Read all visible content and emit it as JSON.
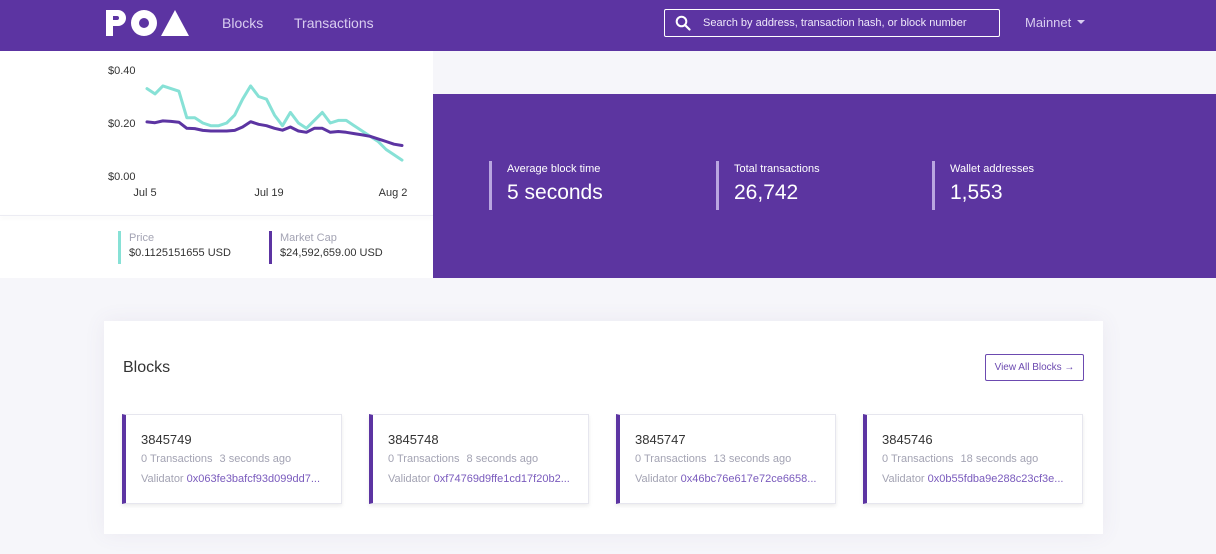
{
  "navbar": {
    "brand": "POA",
    "links": [
      {
        "label": "Blocks"
      },
      {
        "label": "Transactions"
      }
    ],
    "search_placeholder": "Search by address, transaction hash, or block number",
    "network": "Mainnet"
  },
  "chart_data": {
    "type": "line",
    "x_tick_labels": [
      "Jul 5",
      "Jul 19",
      "Aug 2"
    ],
    "y_tick_labels": [
      "$0.40",
      "$0.20",
      "$0.00"
    ],
    "ylim": [
      0,
      0.4
    ],
    "series": [
      {
        "name": "Price",
        "color": "#87e1d6",
        "values": [
          0.33,
          0.31,
          0.34,
          0.33,
          0.32,
          0.22,
          0.22,
          0.2,
          0.19,
          0.19,
          0.2,
          0.23,
          0.29,
          0.34,
          0.3,
          0.29,
          0.23,
          0.19,
          0.24,
          0.2,
          0.18,
          0.21,
          0.24,
          0.2,
          0.21,
          0.21,
          0.19,
          0.17,
          0.15,
          0.13,
          0.1,
          0.08,
          0.06
        ]
      },
      {
        "name": "Market Cap",
        "color": "#5c34a2",
        "values": [
          0.204,
          0.201,
          0.208,
          0.206,
          0.203,
          0.18,
          0.179,
          0.172,
          0.17,
          0.17,
          0.17,
          0.172,
          0.185,
          0.205,
          0.195,
          0.19,
          0.18,
          0.173,
          0.185,
          0.17,
          0.165,
          0.18,
          0.18,
          0.165,
          0.168,
          0.165,
          0.16,
          0.155,
          0.15,
          0.14,
          0.13,
          0.12,
          0.115
        ]
      }
    ]
  },
  "legend": {
    "price_label": "Price",
    "price_value": "$0.1125151655 USD",
    "mcap_label": "Market Cap",
    "mcap_value": "$24,592,659.00 USD"
  },
  "stats": [
    {
      "label": "Average block time",
      "value": "5 seconds"
    },
    {
      "label": "Total transactions",
      "value": "26,742"
    },
    {
      "label": "Wallet addresses",
      "value": "1,553"
    }
  ],
  "blocks": {
    "title": "Blocks",
    "view_all": "View All Blocks →",
    "validator_label": "Validator",
    "items": [
      {
        "number": "3845749",
        "transactions": "0 Transactions",
        "age": "3 seconds ago",
        "validator": "0x063fe3bafcf93d099dd7..."
      },
      {
        "number": "3845748",
        "transactions": "0 Transactions",
        "age": "8 seconds ago",
        "validator": "0xf74769d9ffe1cd17f20b2..."
      },
      {
        "number": "3845747",
        "transactions": "0 Transactions",
        "age": "13 seconds ago",
        "validator": "0x46bc76e617e72ce6658..."
      },
      {
        "number": "3845746",
        "transactions": "0 Transactions",
        "age": "18 seconds ago",
        "validator": "0x0b55fdba9e288c23cf3e..."
      }
    ]
  }
}
